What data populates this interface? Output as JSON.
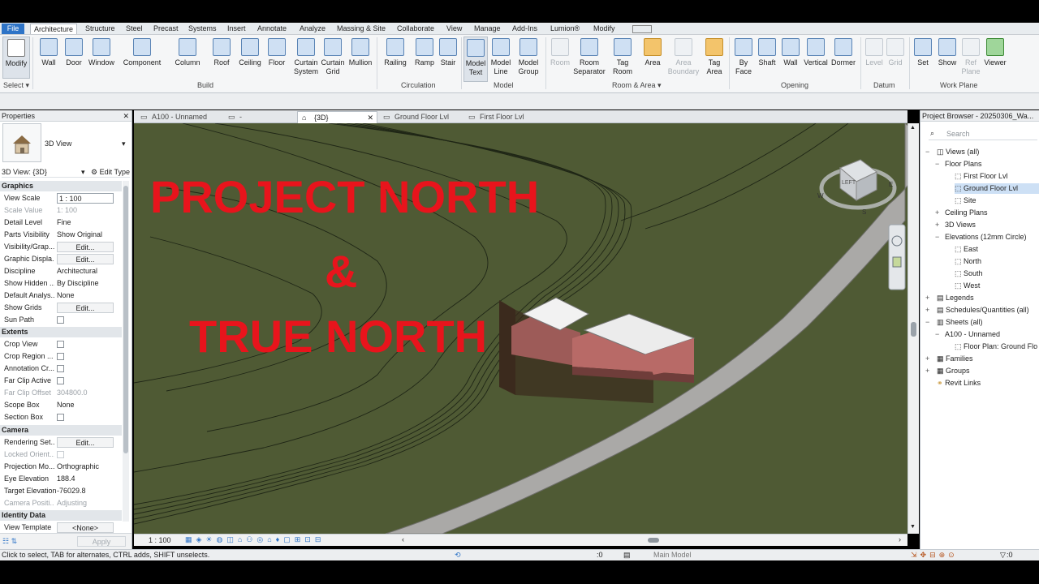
{
  "menus": [
    "File",
    "Architecture",
    "Structure",
    "Steel",
    "Precast",
    "Systems",
    "Insert",
    "Annotate",
    "Analyze",
    "Massing & Site",
    "Collaborate",
    "View",
    "Manage",
    "Add-Ins",
    "Lumion®",
    "Modify"
  ],
  "ribbon": {
    "tools": [
      {
        "l1": "Modify",
        "l2": ""
      },
      {
        "l1": "Wall",
        "l2": ""
      },
      {
        "l1": "Door",
        "l2": ""
      },
      {
        "l1": "Window",
        "l2": ""
      },
      {
        "l1": "Component",
        "l2": ""
      },
      {
        "l1": "Column",
        "l2": ""
      },
      {
        "l1": "Roof",
        "l2": ""
      },
      {
        "l1": "Ceiling",
        "l2": ""
      },
      {
        "l1": "Floor",
        "l2": ""
      },
      {
        "l1": "Curtain",
        "l2": "System"
      },
      {
        "l1": "Curtain",
        "l2": "Grid"
      },
      {
        "l1": "Mullion",
        "l2": ""
      },
      {
        "l1": "Railing",
        "l2": ""
      },
      {
        "l1": "Ramp",
        "l2": ""
      },
      {
        "l1": "Stair",
        "l2": ""
      },
      {
        "l1": "Model",
        "l2": "Text"
      },
      {
        "l1": "Model",
        "l2": "Line"
      },
      {
        "l1": "Model",
        "l2": "Group"
      },
      {
        "l1": "Room",
        "l2": ""
      },
      {
        "l1": "Room",
        "l2": "Separator"
      },
      {
        "l1": "Tag",
        "l2": "Room"
      },
      {
        "l1": "Area",
        "l2": ""
      },
      {
        "l1": "Area",
        "l2": "Boundary"
      },
      {
        "l1": "Tag",
        "l2": "Area"
      },
      {
        "l1": "By",
        "l2": "Face"
      },
      {
        "l1": "Shaft",
        "l2": ""
      },
      {
        "l1": "Wall",
        "l2": ""
      },
      {
        "l1": "Vertical",
        "l2": ""
      },
      {
        "l1": "Dormer",
        "l2": ""
      },
      {
        "l1": "Level",
        "l2": ""
      },
      {
        "l1": "Grid",
        "l2": ""
      },
      {
        "l1": "Set",
        "l2": ""
      },
      {
        "l1": "Show",
        "l2": ""
      },
      {
        "l1": "Ref",
        "l2": "Plane"
      },
      {
        "l1": "Viewer",
        "l2": ""
      }
    ],
    "groups": [
      "Select",
      "Build",
      "Circulation",
      "Model",
      "Room & Area",
      "Opening",
      "Datum",
      "Work Plane"
    ]
  },
  "properties": {
    "title": "Properties",
    "type_name": "3D View",
    "selector": "3D View: {3D}",
    "edit_type": "Edit Type",
    "sections": {
      "graphics": "Graphics",
      "extents": "Extents",
      "camera": "Camera",
      "identity": "Identity Data"
    },
    "rows": [
      {
        "k": "View Scale",
        "v": "1 : 100"
      },
      {
        "k": "Scale Value",
        "v": "1:  100"
      },
      {
        "k": "Detail Level",
        "v": "Fine"
      },
      {
        "k": "Parts Visibility",
        "v": "Show Original"
      },
      {
        "k": "Visibility/Grap...",
        "v": "Edit..."
      },
      {
        "k": "Graphic Displa...",
        "v": "Edit..."
      },
      {
        "k": "Discipline",
        "v": "Architectural"
      },
      {
        "k": "Show Hidden ...",
        "v": "By Discipline"
      },
      {
        "k": "Default Analys...",
        "v": "None"
      },
      {
        "k": "Show Grids",
        "v": "Edit..."
      },
      {
        "k": "Sun Path",
        "v": ""
      },
      {
        "k": "Crop View",
        "v": ""
      },
      {
        "k": "Crop Region ...",
        "v": ""
      },
      {
        "k": "Annotation Cr...",
        "v": ""
      },
      {
        "k": "Far Clip Active",
        "v": ""
      },
      {
        "k": "Far Clip Offset",
        "v": "304800.0"
      },
      {
        "k": "Scope Box",
        "v": "None"
      },
      {
        "k": "Section Box",
        "v": ""
      },
      {
        "k": "Rendering Set...",
        "v": "Edit..."
      },
      {
        "k": "Locked Orient...",
        "v": ""
      },
      {
        "k": "Projection Mo...",
        "v": "Orthographic"
      },
      {
        "k": "Eye Elevation",
        "v": "188.4"
      },
      {
        "k": "Target Elevation",
        "v": "-76029.8"
      },
      {
        "k": "Camera Positi...",
        "v": "Adjusting"
      },
      {
        "k": "View Template",
        "v": "<None>"
      }
    ],
    "apply": "Apply"
  },
  "tabs": [
    "A100 - Unnamed",
    "-",
    "{3D}",
    "Ground Floor Lvl",
    "First Floor Lvl"
  ],
  "overlay": {
    "line1": "PROJECT NORTH",
    "line2": "&",
    "line3": "TRUE NORTH"
  },
  "viewcube": {
    "face": "LEFT",
    "compass": [
      "W",
      "S",
      "E"
    ]
  },
  "viewbar": {
    "scale": "1 : 100"
  },
  "browser": {
    "title": "Project Browser - 20250306_Wa...",
    "search": "Search",
    "items": [
      "Views (all)",
      "Floor Plans",
      "First Floor Lvl",
      "Ground Floor Lvl",
      "Site",
      "Ceiling Plans",
      "3D Views",
      "Elevations (12mm Circle)",
      "East",
      "North",
      "South",
      "West",
      "Legends",
      "Schedules/Quantities (all)",
      "Sheets (all)",
      "A100 - Unnamed",
      "Floor Plan: Ground Flo",
      "Families",
      "Groups",
      "Revit Links"
    ]
  },
  "status": {
    "text": "Click to select, TAB for alternates, CTRL adds, SHIFT unselects.",
    "count": ":0",
    "model": "Main Model",
    "filter": ":0"
  },
  "colors": {
    "terrain": "#4f5a34",
    "overlay_text": "#e8141c",
    "ribbon_accent": "#2e74c7"
  }
}
